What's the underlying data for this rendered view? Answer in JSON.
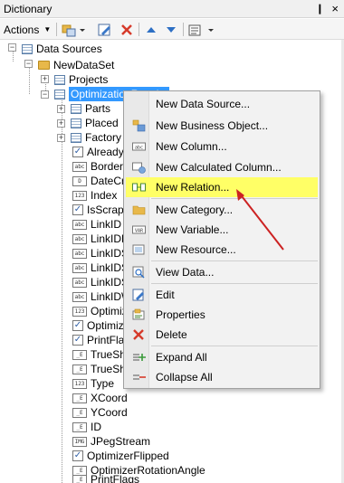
{
  "window": {
    "title": "Dictionary",
    "pin_glyph": "❙",
    "close_glyph": "×"
  },
  "toolbar": {
    "actions_label": "Actions"
  },
  "tree": {
    "root": "Data Sources",
    "dataset": "NewDataSet",
    "items": [
      "Projects",
      "OptimizationResults",
      "Parts",
      "Placed",
      "Factory",
      "Already",
      "BorderC",
      "DateCr",
      "Index",
      "IsScrap",
      "LinkID",
      "LinkIDF",
      "LinkIDS",
      "LinkIDS",
      "LinkIDS",
      "LinkIDW",
      "Optimiz",
      "Optimiz",
      "PrintFla",
      "TrueSh",
      "TrueSh",
      "Type",
      "XCoord",
      "YCoord",
      "ID",
      "JPegStream",
      "OptimizerFlipped",
      "OptimizerRotationAngle",
      "PrintFlags"
    ],
    "field_types": {
      "check": "✓",
      "string": "abc",
      "number": "123",
      "expr": "_E",
      "date": "D",
      "img": "IMG"
    }
  },
  "context_menu": {
    "items": [
      {
        "label": "New Data Source..."
      },
      {
        "label": "New Business Object..."
      },
      {
        "label": "New Column..."
      },
      {
        "label": "New Calculated Column..."
      },
      {
        "label": "New Relation..."
      },
      {
        "label": "New Category..."
      },
      {
        "label": "New Variable..."
      },
      {
        "label": "New Resource..."
      },
      {
        "label": "View Data..."
      },
      {
        "label": "Edit"
      },
      {
        "label": "Properties"
      },
      {
        "label": "Delete"
      },
      {
        "label": "Expand All"
      },
      {
        "label": "Collapse All"
      }
    ],
    "highlight_color": "#ffff66"
  },
  "annotation": {
    "arrow_color": "#cc2222"
  }
}
